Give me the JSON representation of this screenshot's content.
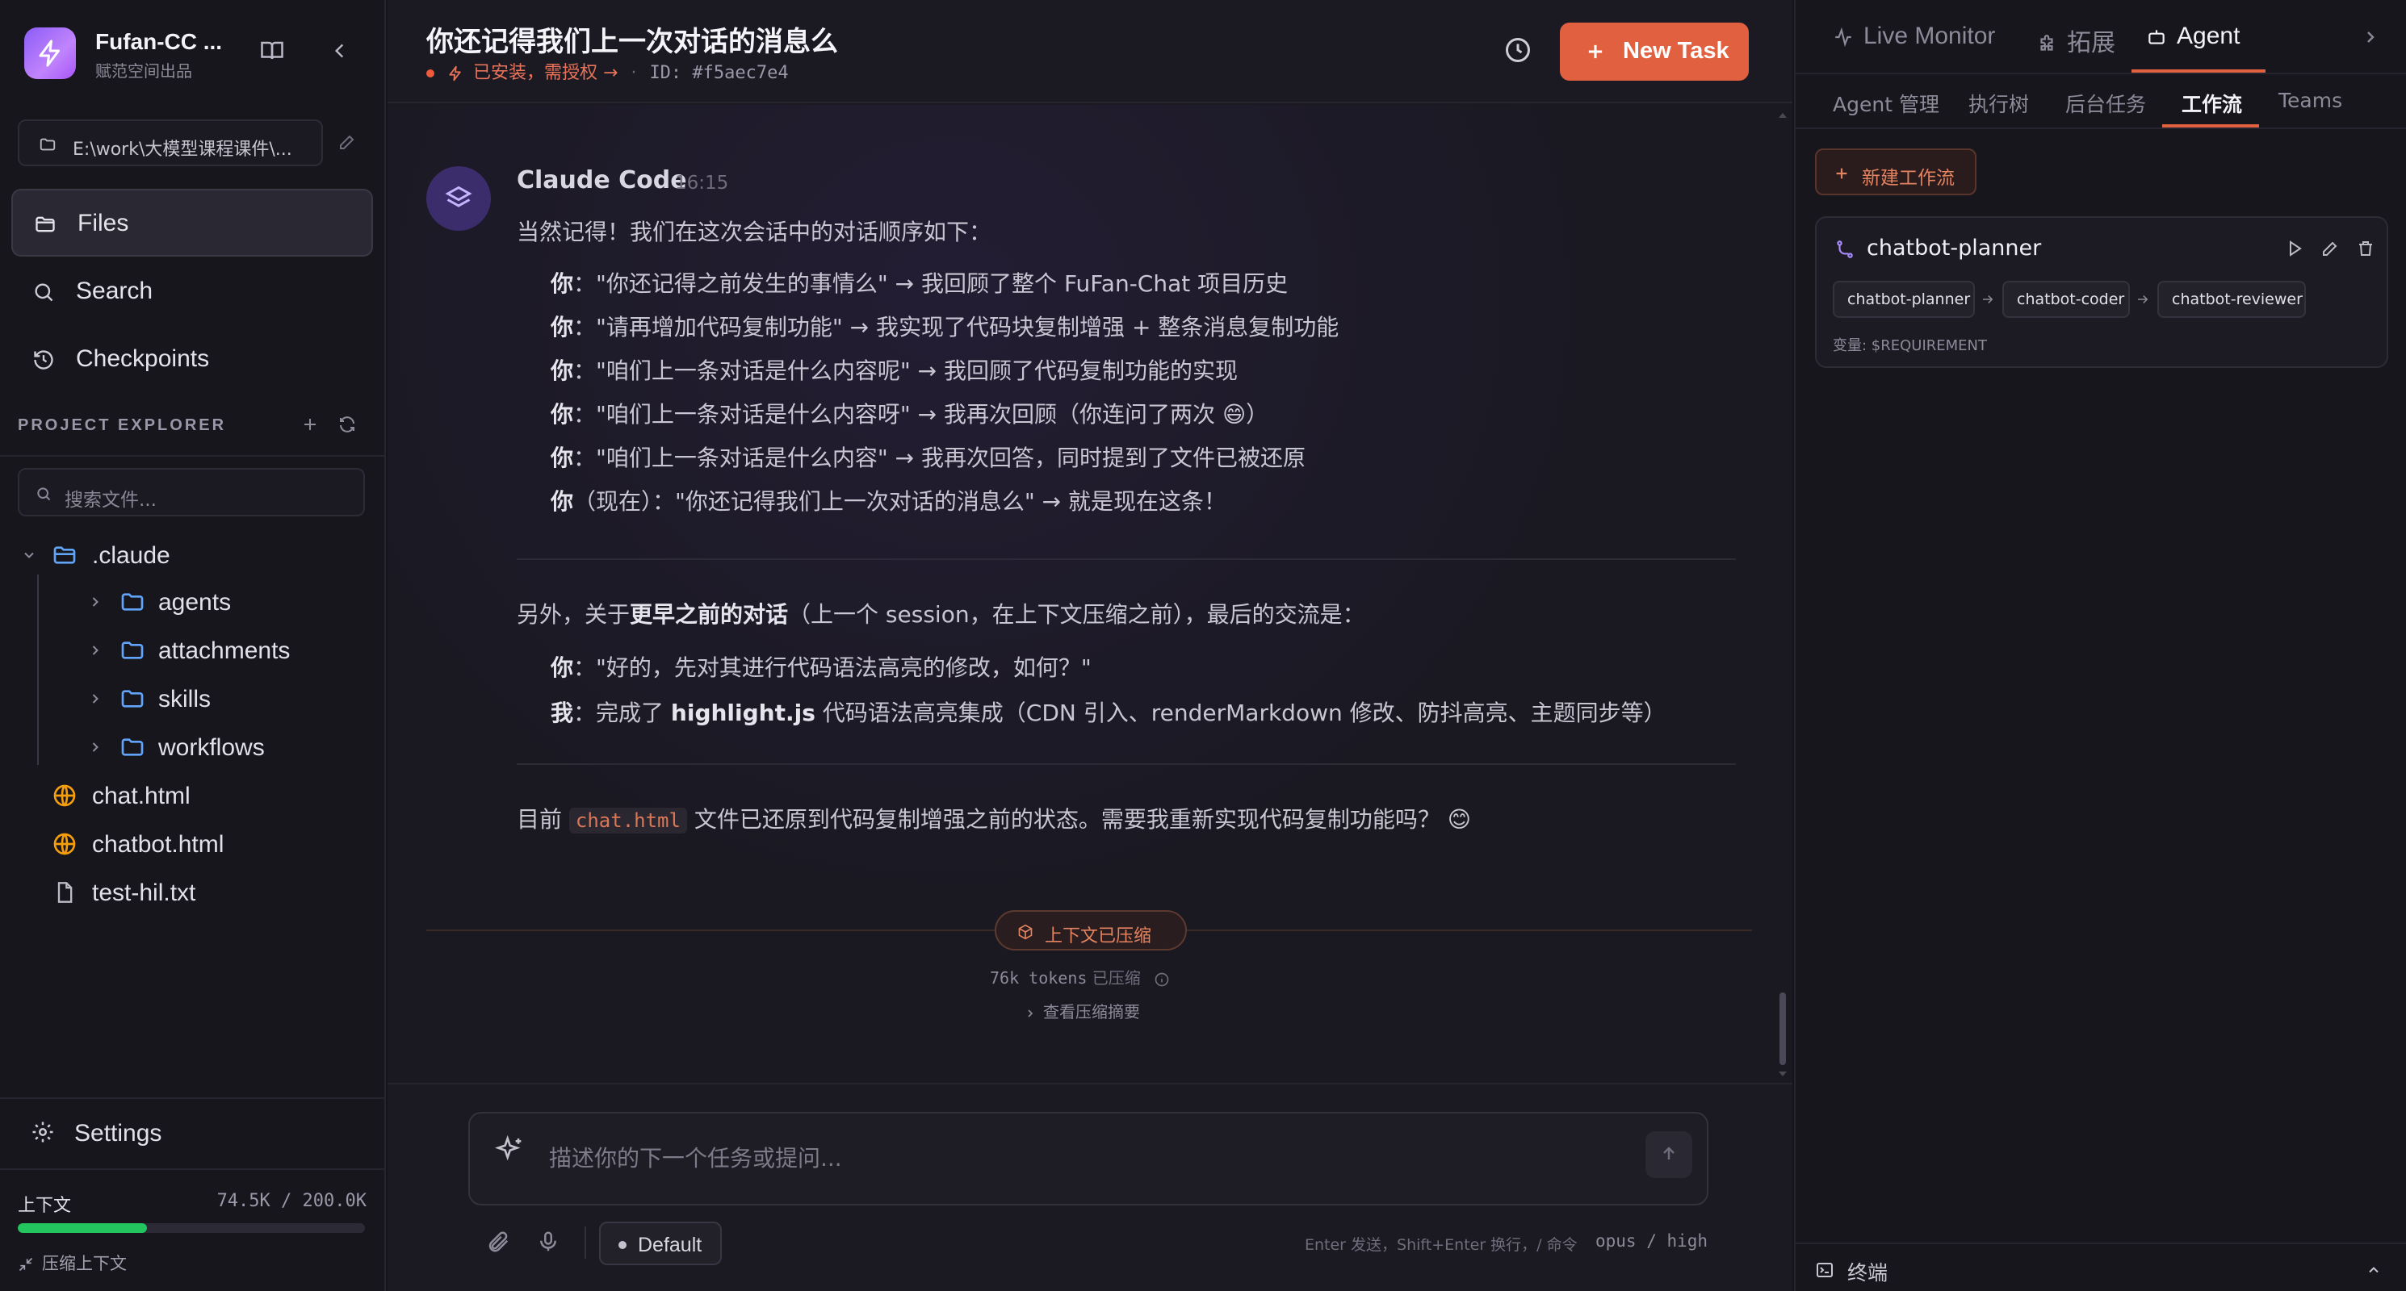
{
  "brand": {
    "name": "Fufan-CC ...",
    "subtitle": "赋范空间出品"
  },
  "sidebar": {
    "workdir": "E:\\work\\大模型课程课件\\...",
    "nav": {
      "files": "Files",
      "search": "Search",
      "checkpoints": "Checkpoints"
    },
    "project_explorer": "PROJECT EXPLORER",
    "file_search_placeholder": "搜索文件...",
    "tree": {
      "root": ".claude",
      "folders": [
        "agents",
        "attachments",
        "skills",
        "workflows"
      ],
      "files": [
        "chat.html",
        "chatbot.html",
        "test-hil.txt"
      ]
    },
    "settings": "Settings",
    "context": {
      "label": "上下文",
      "value": "74.5K / 200.0K",
      "ratio": 0.3725,
      "compress": "压缩上下文"
    }
  },
  "header": {
    "title": "你还记得我们上一次对话的消息么",
    "status": "已安装，需授权 →",
    "session_id": "ID: #f5aec7e4",
    "new_task": "New Task"
  },
  "message": {
    "author": "Claude Code",
    "time": "16:15",
    "intro": "当然记得！我们在这次会话中的对话顺序如下：",
    "items": [
      {
        "who": "你",
        "text": "：\"你还记得之前发生的事情么\" → 我回顾了整个 FuFan-Chat 项目历史"
      },
      {
        "who": "你",
        "text": "：\"请再增加代码复制功能\" → 我实现了代码块复制增强 + 整条消息复制功能"
      },
      {
        "who": "你",
        "text": "：\"咱们上一条对话是什么内容呢\" → 我回顾了代码复制功能的实现"
      },
      {
        "who": "你",
        "text": "：\"咱们上一条对话是什么内容呀\" → 我再次回顾（你连问了两次 😄）"
      },
      {
        "who": "你",
        "text": "：\"咱们上一条对话是什么内容\" → 我再次回答，同时提到了文件已被还原"
      },
      {
        "who": "你",
        "text": "（现在）：\"你还记得我们上一次对话的消息么\" → 就是现在这条！"
      }
    ],
    "earlier_prefix": "另外，关于",
    "earlier_bold": "更早之前的对话",
    "earlier_suffix": "（上一个 session，在上下文压缩之前），最后的交流是：",
    "earlier_items": [
      {
        "who": "你",
        "pre": "：\"好的，先对其进行代码语法高亮的修改，如何？\"",
        "bold": "",
        "post": ""
      },
      {
        "who": "我",
        "pre": "：完成了 ",
        "bold": "highlight.js",
        "post": " 代码语法高亮集成（CDN 引入、renderMarkdown 修改、防抖高亮、主题同步等）"
      }
    ],
    "closing_pre": "目前 ",
    "closing_code": "chat.html",
    "closing_post": " 文件已还原到代码复制增强之前的状态。需要我重新实现代码复制功能吗？ 😊"
  },
  "compaction": {
    "badge": "上下文已压缩",
    "tokens": "76k tokens",
    "tokens_suffix": "已压缩",
    "summary": "查看压缩摘要"
  },
  "composer": {
    "placeholder": "描述你的下一个任务或提问...",
    "model_pill": "Default",
    "hint": "Enter 发送，Shift+Enter 换行，/ 命令",
    "model_info": "opus / high"
  },
  "right": {
    "tabs": [
      "Live Monitor",
      "拓展",
      "Agent"
    ],
    "active_tab": "Agent",
    "subtabs": [
      "Agent 管理",
      "执行树",
      "后台任务",
      "工作流",
      "Teams"
    ],
    "active_subtab": "工作流",
    "new_workflow": "新建工作流",
    "workflow": {
      "name": "chatbot-planner",
      "steps": [
        "chatbot-planner",
        "chatbot-coder",
        "chatbot-reviewer"
      ],
      "variables": "变量: $REQUIREMENT"
    },
    "terminal": "终端"
  },
  "colors": {
    "accent": "#e0603f",
    "progress": "#22c55e",
    "brand": "#a855f7"
  }
}
